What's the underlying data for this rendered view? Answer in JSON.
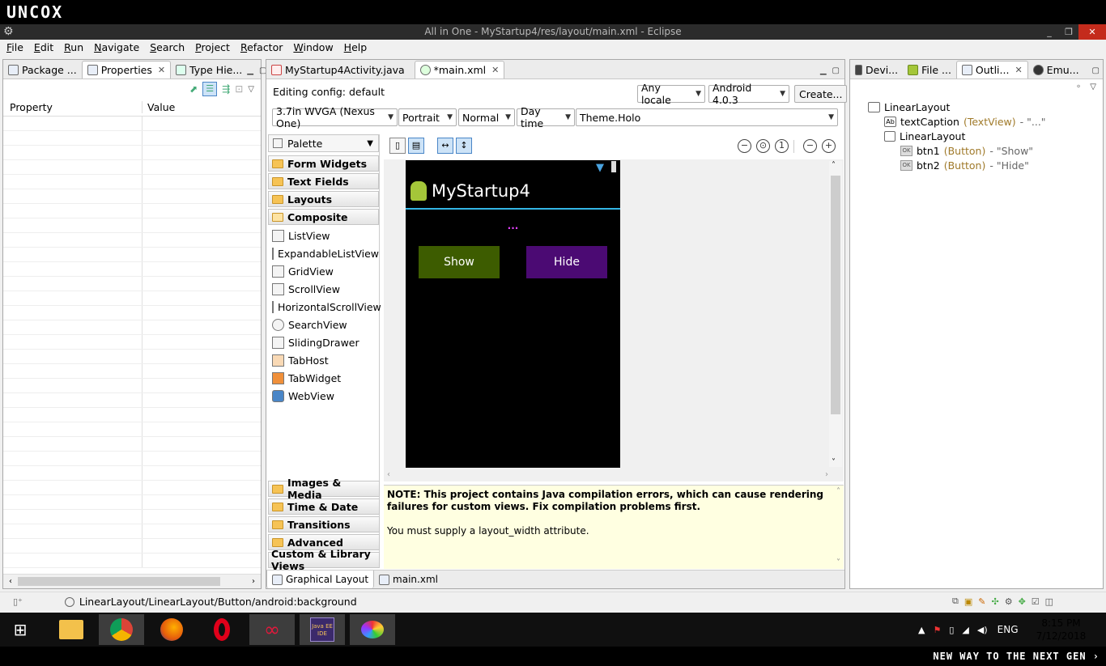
{
  "brand": {
    "logo_text": "UNCOX"
  },
  "window": {
    "title": "All in One - MyStartup4/res/layout/main.xml - Eclipse",
    "min": "_",
    "restore": "❐",
    "close": "✕"
  },
  "menu": [
    "File",
    "Edit",
    "Run",
    "Navigate",
    "Search",
    "Project",
    "Refactor",
    "Window",
    "Help"
  ],
  "left_panel": {
    "tabs": [
      "Package ...",
      "Properties",
      "Type Hie..."
    ],
    "columns": [
      "Property",
      "Value"
    ]
  },
  "editor": {
    "tabs": [
      "MyStartup4Activity.java",
      "*main.xml"
    ],
    "editing_config_label": "Editing config:",
    "editing_config_value": "default",
    "locale": "Any locale",
    "android_version": "Android 4.0.3",
    "create_button": "Create...",
    "device": "3.7in WVGA (Nexus One)",
    "orientation": "Portrait",
    "mode": "Normal",
    "time": "Day time",
    "theme": "Theme.Holo",
    "bottom_tabs": [
      "Graphical Layout",
      "main.xml"
    ]
  },
  "palette": {
    "title": "Palette",
    "top_categories": [
      "Form Widgets",
      "Text Fields",
      "Layouts",
      "Composite"
    ],
    "items": [
      "ListView",
      "ExpandableListView",
      "GridView",
      "ScrollView",
      "HorizontalScrollView",
      "SearchView",
      "SlidingDrawer",
      "TabHost",
      "TabWidget",
      "WebView"
    ],
    "bottom_categories": [
      "Images & Media",
      "Time & Date",
      "Transitions",
      "Advanced"
    ],
    "custom": "Custom & Library Views"
  },
  "device_preview": {
    "app_title": "MyStartup4",
    "caption": "...",
    "btn_show": "Show",
    "btn_hide": "Hide",
    "show_color": "#3d5c00",
    "hide_color": "#4b0a73"
  },
  "note": {
    "bold": "NOTE: This project contains Java compilation errors, which can cause rendering failures for custom views. Fix compilation problems first.",
    "text": "You must supply a layout_width attribute."
  },
  "right_panel": {
    "tabs": [
      "Devi...",
      "File ...",
      "Outli...",
      "Emu..."
    ],
    "outline": [
      {
        "name": "LinearLayout",
        "type": "",
        "value": ""
      },
      {
        "name": "textCaption",
        "type": "(TextView)",
        "value": "- \"...\""
      },
      {
        "name": "LinearLayout",
        "type": "",
        "value": ""
      },
      {
        "name": "btn1",
        "type": "(Button)",
        "value": "- \"Show\""
      },
      {
        "name": "btn2",
        "type": "(Button)",
        "value": "- \"Hide\""
      }
    ]
  },
  "status": {
    "path": "LinearLayout/LinearLayout/Button/android:background"
  },
  "taskbar": {
    "lang": "ENG",
    "time": "8:15 PM",
    "date": "7/12/2018",
    "java_ee_label": "Java EE IDE"
  },
  "footer": {
    "slogan": "NEW WAY TO THE NEXT GEN ›"
  }
}
